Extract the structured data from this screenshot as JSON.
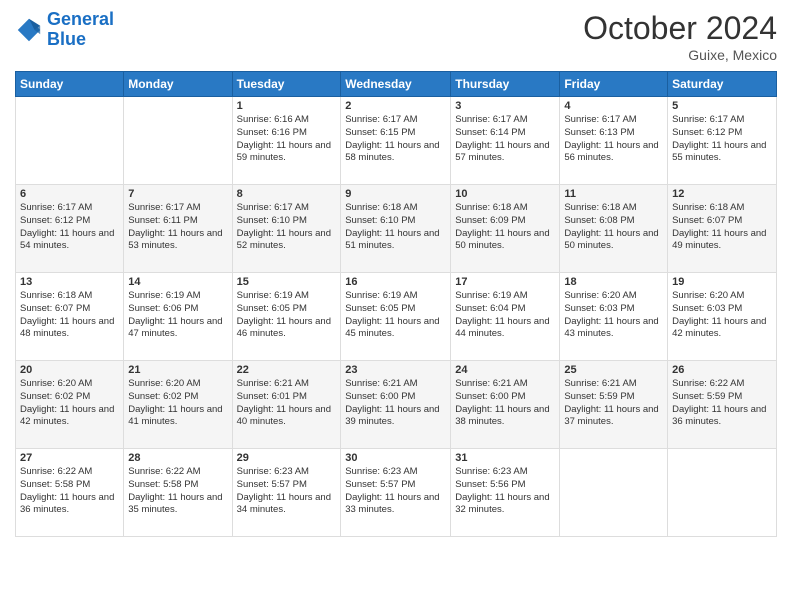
{
  "header": {
    "logo_line1": "General",
    "logo_line2": "Blue",
    "month": "October 2024",
    "location": "Guixe, Mexico"
  },
  "weekdays": [
    "Sunday",
    "Monday",
    "Tuesday",
    "Wednesday",
    "Thursday",
    "Friday",
    "Saturday"
  ],
  "weeks": [
    [
      {
        "day": "",
        "info": ""
      },
      {
        "day": "",
        "info": ""
      },
      {
        "day": "1",
        "info": "Sunrise: 6:16 AM\nSunset: 6:16 PM\nDaylight: 11 hours and 59 minutes."
      },
      {
        "day": "2",
        "info": "Sunrise: 6:17 AM\nSunset: 6:15 PM\nDaylight: 11 hours and 58 minutes."
      },
      {
        "day": "3",
        "info": "Sunrise: 6:17 AM\nSunset: 6:14 PM\nDaylight: 11 hours and 57 minutes."
      },
      {
        "day": "4",
        "info": "Sunrise: 6:17 AM\nSunset: 6:13 PM\nDaylight: 11 hours and 56 minutes."
      },
      {
        "day": "5",
        "info": "Sunrise: 6:17 AM\nSunset: 6:12 PM\nDaylight: 11 hours and 55 minutes."
      }
    ],
    [
      {
        "day": "6",
        "info": "Sunrise: 6:17 AM\nSunset: 6:12 PM\nDaylight: 11 hours and 54 minutes."
      },
      {
        "day": "7",
        "info": "Sunrise: 6:17 AM\nSunset: 6:11 PM\nDaylight: 11 hours and 53 minutes."
      },
      {
        "day": "8",
        "info": "Sunrise: 6:17 AM\nSunset: 6:10 PM\nDaylight: 11 hours and 52 minutes."
      },
      {
        "day": "9",
        "info": "Sunrise: 6:18 AM\nSunset: 6:10 PM\nDaylight: 11 hours and 51 minutes."
      },
      {
        "day": "10",
        "info": "Sunrise: 6:18 AM\nSunset: 6:09 PM\nDaylight: 11 hours and 50 minutes."
      },
      {
        "day": "11",
        "info": "Sunrise: 6:18 AM\nSunset: 6:08 PM\nDaylight: 11 hours and 50 minutes."
      },
      {
        "day": "12",
        "info": "Sunrise: 6:18 AM\nSunset: 6:07 PM\nDaylight: 11 hours and 49 minutes."
      }
    ],
    [
      {
        "day": "13",
        "info": "Sunrise: 6:18 AM\nSunset: 6:07 PM\nDaylight: 11 hours and 48 minutes."
      },
      {
        "day": "14",
        "info": "Sunrise: 6:19 AM\nSunset: 6:06 PM\nDaylight: 11 hours and 47 minutes."
      },
      {
        "day": "15",
        "info": "Sunrise: 6:19 AM\nSunset: 6:05 PM\nDaylight: 11 hours and 46 minutes."
      },
      {
        "day": "16",
        "info": "Sunrise: 6:19 AM\nSunset: 6:05 PM\nDaylight: 11 hours and 45 minutes."
      },
      {
        "day": "17",
        "info": "Sunrise: 6:19 AM\nSunset: 6:04 PM\nDaylight: 11 hours and 44 minutes."
      },
      {
        "day": "18",
        "info": "Sunrise: 6:20 AM\nSunset: 6:03 PM\nDaylight: 11 hours and 43 minutes."
      },
      {
        "day": "19",
        "info": "Sunrise: 6:20 AM\nSunset: 6:03 PM\nDaylight: 11 hours and 42 minutes."
      }
    ],
    [
      {
        "day": "20",
        "info": "Sunrise: 6:20 AM\nSunset: 6:02 PM\nDaylight: 11 hours and 42 minutes."
      },
      {
        "day": "21",
        "info": "Sunrise: 6:20 AM\nSunset: 6:02 PM\nDaylight: 11 hours and 41 minutes."
      },
      {
        "day": "22",
        "info": "Sunrise: 6:21 AM\nSunset: 6:01 PM\nDaylight: 11 hours and 40 minutes."
      },
      {
        "day": "23",
        "info": "Sunrise: 6:21 AM\nSunset: 6:00 PM\nDaylight: 11 hours and 39 minutes."
      },
      {
        "day": "24",
        "info": "Sunrise: 6:21 AM\nSunset: 6:00 PM\nDaylight: 11 hours and 38 minutes."
      },
      {
        "day": "25",
        "info": "Sunrise: 6:21 AM\nSunset: 5:59 PM\nDaylight: 11 hours and 37 minutes."
      },
      {
        "day": "26",
        "info": "Sunrise: 6:22 AM\nSunset: 5:59 PM\nDaylight: 11 hours and 36 minutes."
      }
    ],
    [
      {
        "day": "27",
        "info": "Sunrise: 6:22 AM\nSunset: 5:58 PM\nDaylight: 11 hours and 36 minutes."
      },
      {
        "day": "28",
        "info": "Sunrise: 6:22 AM\nSunset: 5:58 PM\nDaylight: 11 hours and 35 minutes."
      },
      {
        "day": "29",
        "info": "Sunrise: 6:23 AM\nSunset: 5:57 PM\nDaylight: 11 hours and 34 minutes."
      },
      {
        "day": "30",
        "info": "Sunrise: 6:23 AM\nSunset: 5:57 PM\nDaylight: 11 hours and 33 minutes."
      },
      {
        "day": "31",
        "info": "Sunrise: 6:23 AM\nSunset: 5:56 PM\nDaylight: 11 hours and 32 minutes."
      },
      {
        "day": "",
        "info": ""
      },
      {
        "day": "",
        "info": ""
      }
    ]
  ]
}
